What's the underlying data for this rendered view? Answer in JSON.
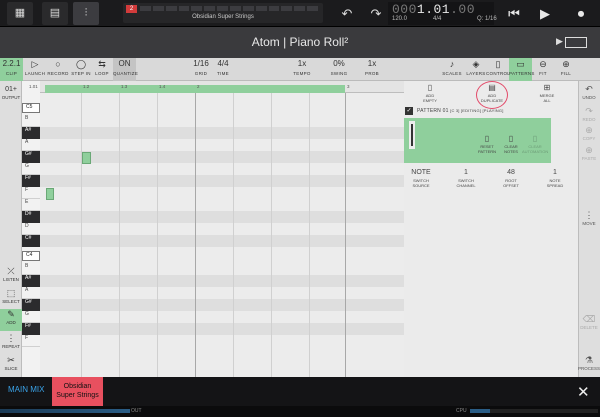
{
  "host": {
    "track_number": "2",
    "track_name": "Obsidian Super Strings",
    "time": "1.01",
    "time_suffix": ".00",
    "time_prefix": "000",
    "tempo": "120.0",
    "time_signature": "4/4",
    "quantize_readout": "Q: 1/16"
  },
  "window": {
    "title": "Atom | Piano Roll²"
  },
  "toolbar": {
    "clip_value": "2.2.1",
    "clip_label": "CLIP",
    "launch_label": "LAUNCH",
    "record_label": "RECORD",
    "step_in_label": "STEP IN",
    "loop_label": "LOOP",
    "quantize_value": "ON",
    "quantize_label": "QUANTIZE",
    "grid_value": "1/16",
    "grid_label": "GRID",
    "time_value": "4/4",
    "time_label": "TIME",
    "tempo_value": "1x",
    "tempo_label": "TEMPO",
    "swing_value": "0%",
    "swing_label": "SWING",
    "prob_value": "1x",
    "prob_label": "PROB",
    "scales_label": "SCALES",
    "layers_label": "LAYERS",
    "controls_label": "CONTROLS",
    "patterns_label": "PATTERNS",
    "fit_label": "FIT",
    "fill_label": "FILL"
  },
  "left": {
    "output_value": "01+",
    "output_label": "OUTPUT",
    "listen_label": "LISTEN",
    "select_label": "SELECT",
    "add_label": "ADD",
    "repeat_label": "REPEAT",
    "slice_label": "SLICE"
  },
  "keys": {
    "c5": "C5",
    "b": "B",
    "as": "A#",
    "a": "A",
    "gs": "G#",
    "g": "G",
    "fs": "F#",
    "f": "F",
    "e": "E",
    "ds": "D#",
    "d": "D",
    "cs": "C#",
    "c4": "C4",
    "b2": "B",
    "as2": "A#",
    "a2": "A",
    "gs2": "G#",
    "g2": "G",
    "fs2": "F#",
    "f2": "F"
  },
  "ruler": {
    "start": "1.01",
    "m2": "1.2",
    "m3": "1.3",
    "m4": "1.4",
    "b2": "2",
    "b3": "3"
  },
  "panel": {
    "add_empty_label": "ADD\nEMPTY",
    "add_duplicate_label": "ADD\nDUPLICATE",
    "merge_all_label": "MERGE\nALL",
    "pattern_title": "PATTERN 01",
    "pattern_status": "[C 3]  [EDITING]  [PLAYING]",
    "reset_label": "RESET\nPATTERN",
    "clear_label": "CLEAR\nNOTES",
    "clear_auto_label": "CLEAR\nAUTOMATION",
    "switch_source_value": "NOTE",
    "switch_source_label": "SWITCH\nSOURCE",
    "switch_channel_value": "1",
    "switch_channel_label": "SWITCH\nCHANNEL",
    "root_offset_value": "48",
    "root_offset_label": "ROOT\nOFFSET",
    "note_spread_value": "1",
    "note_spread_label": "NOTE\nSPREAD"
  },
  "right": {
    "undo_label": "UNDO",
    "redo_label": "REDO",
    "copy_label": "COPY",
    "paste_label": "PASTE",
    "move_label": "MOVE",
    "delete_label": "DELETE",
    "process_label": "PROCESS"
  },
  "bottom": {
    "main_mix": "MAIN MIX",
    "tab_active": "Obsidian\nSuper Strings",
    "out_label": "OUT",
    "cpu_label": "CPU"
  },
  "colors": {
    "accent_green": "#8fcf9c",
    "accent_red": "#e8505f",
    "mix_blue": "#3aa3e8"
  }
}
